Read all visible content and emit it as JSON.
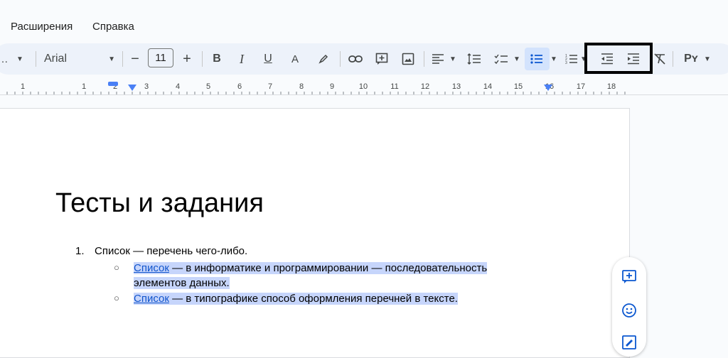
{
  "menu": {
    "extensions": "Расширения",
    "help": "Справка"
  },
  "toolbar": {
    "font_name": "Arial",
    "font_size": "11",
    "minus": "−",
    "plus": "+",
    "bold": "B",
    "italic": "I",
    "underline": "U",
    "text_color": "A",
    "input_tools": "Рʏ"
  },
  "ruler": {
    "numbers": [
      "1",
      "1",
      "2",
      "3",
      "4",
      "5",
      "6",
      "7",
      "8",
      "9",
      "10",
      "11",
      "12",
      "13",
      "14",
      "15",
      "16",
      "17",
      "18"
    ]
  },
  "document": {
    "title": "Тесты и задания",
    "list_number": "1.",
    "item1": "Список — перечень чего-либо.",
    "sub_bullet": "○",
    "sub1_link": "Список",
    "sub1_rest": " — в информатике и программировании — последовательность",
    "sub1_cont": "элементов данных.",
    "sub2_link": "Список",
    "sub2_rest": " — в типографике способ оформления перечней в тексте."
  },
  "colors": {
    "accent": "#0b57d0",
    "selection": "#c6d5fb",
    "link": "#1155cc"
  }
}
